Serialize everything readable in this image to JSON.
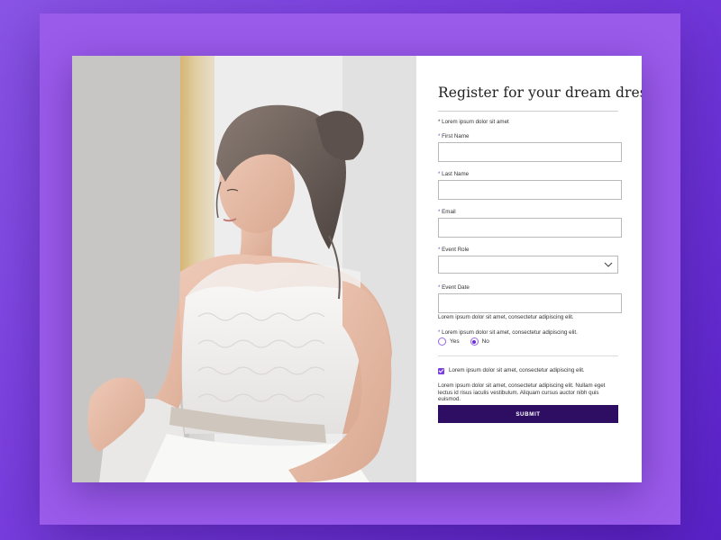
{
  "form": {
    "title": "Register for your dream dress",
    "required_note": "* Lorem ipsum dolor sit amet",
    "fields": [
      {
        "label": "First Name",
        "value": "",
        "placeholder": ""
      },
      {
        "label": "Last Name",
        "value": "",
        "placeholder": ""
      },
      {
        "label": "Email",
        "value": "",
        "placeholder": ""
      },
      {
        "label": "Event Role",
        "value": "",
        "placeholder": ""
      },
      {
        "label": "Event Date",
        "value": "",
        "placeholder": ""
      }
    ],
    "date_help": "Lorem ipsum dolor sit amet, consectetur adipiscing elit.",
    "radio_question": "Lorem ipsum dolor sit amet, consectetur adipiscing elit.",
    "radio_options": [
      {
        "label": "Yes",
        "selected": false
      },
      {
        "label": "No",
        "selected": true
      }
    ],
    "checkbox_label": "Lorem ipsum dolor sit amet, consectetur adipiscing elit.",
    "checkbox_checked": true,
    "note": "Lorem ipsum dolor sit amet, consectetur adipiscing elit. Nullam eget lectus id risus iaculis vestibulum. Aliquam cursus auctor nibh quis euismod.",
    "submit_label": "SUBMIT",
    "required_marker": "*"
  },
  "icons": {
    "dropdown": "chevron-down-icon"
  },
  "colors": {
    "accent": "#7b3fe0",
    "button": "#2d0e63",
    "background": "#8a55e6"
  }
}
